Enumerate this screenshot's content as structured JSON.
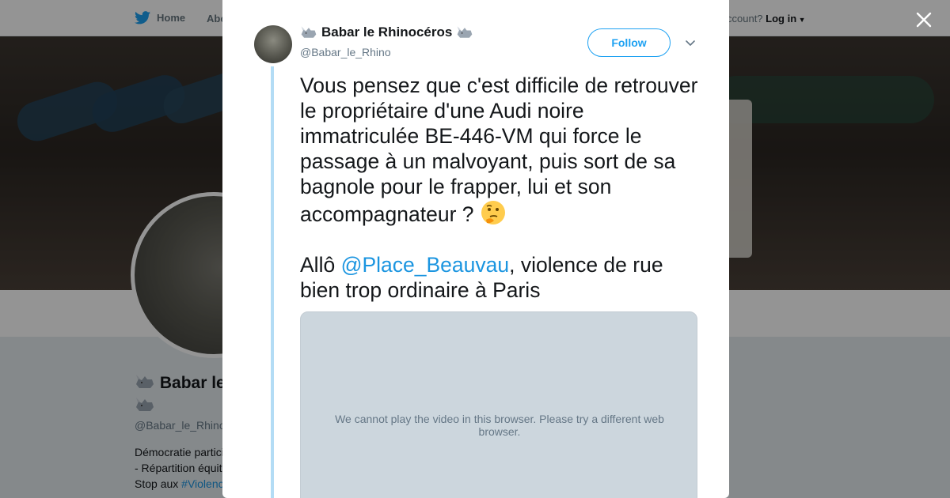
{
  "nav": {
    "home_label": "Home",
    "about_label": "Abo",
    "account_prompt": "ccount?",
    "login_label": "Log in"
  },
  "profile": {
    "name": "Babar le",
    "handle": "@Babar_le_Rhino",
    "bio_line1": "Démocratie partici",
    "bio_line2": "- Répartition équit",
    "bio_line3_prefix": "Stop aux ",
    "bio_line3_tag": "#Violenc"
  },
  "tweet": {
    "author_name": "Babar le Rhinocéros",
    "author_handle": "@Babar_le_Rhino",
    "follow_label": "Follow",
    "text_part1": "Vous pensez que c'est difficile de retrouver le propriétaire d'une Audi noire immatriculée BE-446-VM qui force le passage à un malvoyant, puis sort de sa bagnole pour le frapper, lui et son accompagnateur ?",
    "text_part2_prefix": "Allô ",
    "mention": "@Place_Beauvau",
    "text_part2_suffix": ", violence de rue bien trop ordinaire à Paris",
    "video_message": "We cannot play the video in this browser. Please try a different web browser."
  },
  "icons": {
    "bird": "twitter-bird-icon",
    "rhino": "rhino-emoji-icon",
    "thinking": "thinking-face-emoji-icon",
    "close": "close-icon",
    "caret": "chevron-down-icon"
  },
  "colors": {
    "accent": "#1da1f2",
    "link": "#1b95e0",
    "thread": "#b3dcf5"
  }
}
